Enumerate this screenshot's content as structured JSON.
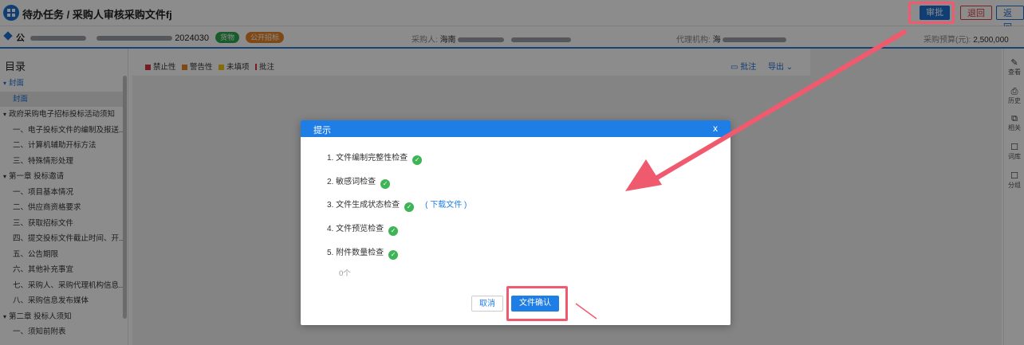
{
  "header": {
    "title": "待办任务 / 采购人审核采购文件fj",
    "approve_label": "审批",
    "return_label": "退回",
    "back_label": "返回"
  },
  "infobar": {
    "project_prefix": "公",
    "project_code_suffix": "2024030",
    "tag_goods": "货物",
    "tag_open": "公开招标",
    "purchaser_label": "采购人:",
    "purchaser_value": "海南",
    "agency_label": "代理机构:",
    "agency_value": "海",
    "budget_label": "采购预算(元):",
    "budget_value": "2,500,000"
  },
  "sidebar": {
    "title": "目录",
    "items": [
      {
        "label": "封面",
        "level": 1,
        "state": "sel",
        "caret": "▾"
      },
      {
        "label": "封面",
        "level": 2,
        "state": "active"
      },
      {
        "label": "政府采购电子招标投标活动须知",
        "level": 1,
        "caret": "▾"
      },
      {
        "label": "一、电子投标文件的编制及报送...",
        "level": 2
      },
      {
        "label": "二、计算机辅助开标方法",
        "level": 2
      },
      {
        "label": "三、特殊情形处理",
        "level": 2
      },
      {
        "label": "第一章 投标邀请",
        "level": 1,
        "caret": "▾"
      },
      {
        "label": "一、项目基本情况",
        "level": 2
      },
      {
        "label": "二、供应商资格要求",
        "level": 2
      },
      {
        "label": "三、获取招标文件",
        "level": 2
      },
      {
        "label": "四、提交投标文件截止时间、开...",
        "level": 2
      },
      {
        "label": "五、公告期限",
        "level": 2
      },
      {
        "label": "六、其他补充事宜",
        "level": 2
      },
      {
        "label": "七、采购人、采购代理机构信息...",
        "level": 2
      },
      {
        "label": "八、采购信息发布媒体",
        "level": 2
      },
      {
        "label": "第二章 投标人须知",
        "level": 1,
        "caret": "▾"
      },
      {
        "label": "一、须知前附表",
        "level": 2
      }
    ]
  },
  "toolbar": {
    "legend": [
      {
        "label": "禁止性",
        "color": "#d9363e"
      },
      {
        "label": "警告性",
        "color": "#e8862b"
      },
      {
        "label": "未填项",
        "color": "#f2c511"
      },
      {
        "label": "批注",
        "color": "#d9363e"
      }
    ],
    "annotate_label": "批注",
    "export_label": "导出"
  },
  "rightbar": {
    "items": [
      {
        "icon": "✎",
        "label": "查看"
      },
      {
        "icon": "⎙",
        "label": "历史"
      },
      {
        "icon": "⧉",
        "label": "相关"
      },
      {
        "icon": "☐",
        "label": "词库"
      },
      {
        "icon": "☐",
        "label": "分组"
      }
    ]
  },
  "dialog": {
    "title": "提示",
    "close": "x",
    "checks": [
      {
        "label": "1.  文件编制完整性检查"
      },
      {
        "label": "2.  敏感词检查"
      },
      {
        "label": "3.  文件生成状态检查",
        "link": "( 下载文件 )"
      },
      {
        "label": "4.  文件预览检查"
      },
      {
        "label": "5.  附件数量检查"
      }
    ],
    "count": "0个",
    "cancel_label": "取消",
    "confirm_label": "文件确认"
  },
  "colors": {
    "primary": "#1e7ee6",
    "annotation": "#f05a6e",
    "success": "#3db455"
  }
}
